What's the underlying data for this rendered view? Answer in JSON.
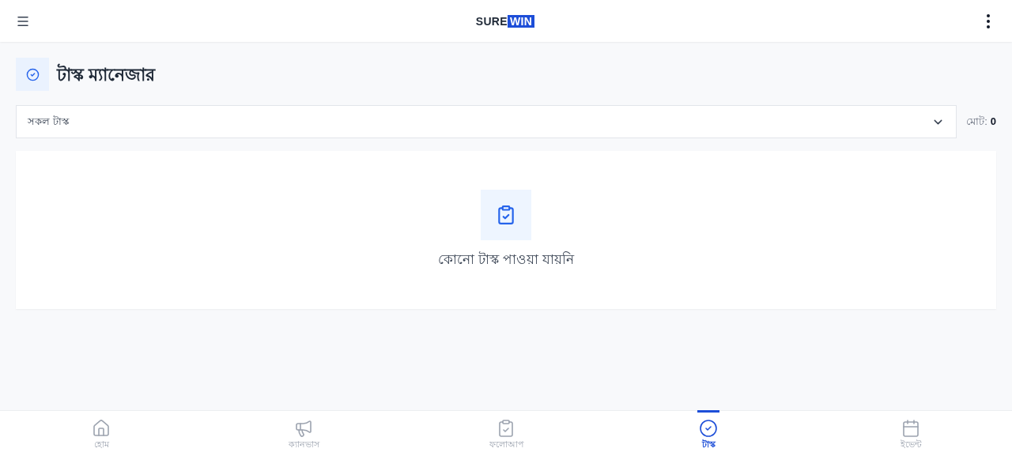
{
  "logo": {
    "part_1": "SURE",
    "part_2": "WIN"
  },
  "page_title": "টাস্ক ম্যানেজার",
  "filter": {
    "value": "সকল টাস্ক"
  },
  "total": {
    "label": "মোট:",
    "value": "0"
  },
  "empty_state": {
    "message": "কোনো টাস্ক পাওয়া যায়নি"
  },
  "bottom_nav": [
    {
      "kind": "home",
      "label": "হোম",
      "selected": false
    },
    {
      "kind": "campaign",
      "label": "ক্যানভাস",
      "selected": false
    },
    {
      "kind": "followup",
      "label": "ফলোআপ",
      "selected": false
    },
    {
      "kind": "task",
      "label": "টাস্ক",
      "selected": true
    },
    {
      "kind": "event",
      "label": "ইভেন্ট",
      "selected": false
    }
  ]
}
